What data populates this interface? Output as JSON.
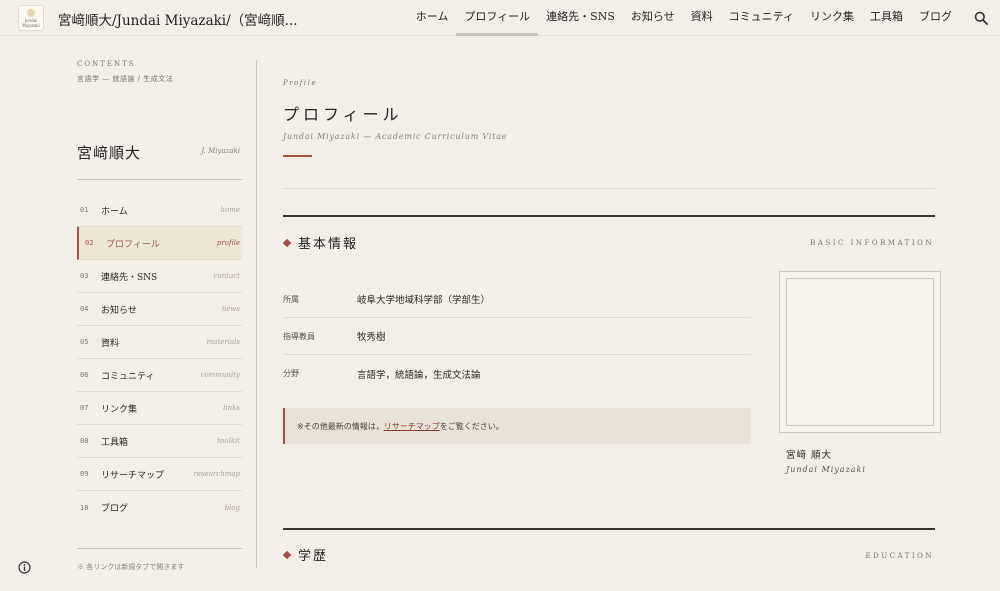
{
  "header": {
    "site_title": "宮﨑順大/Jundai Miyazaki/（宮﨑順...",
    "logo_text_1": "Jundai",
    "logo_text_2": "Miyazaki",
    "nav": [
      {
        "label": "ホーム"
      },
      {
        "label": "プロフィール"
      },
      {
        "label": "連絡先・SNS"
      },
      {
        "label": "お知らせ"
      },
      {
        "label": "資料"
      },
      {
        "label": "コミュニティ"
      },
      {
        "label": "リンク集"
      },
      {
        "label": "工具箱"
      },
      {
        "label": "ブログ"
      }
    ],
    "active_index": 1
  },
  "sidebar": {
    "contents_label": "CONTENTS",
    "contents_sub": "言語学 — 統語論 / 生成文法",
    "name": "宮﨑順大",
    "name_en": "J. Miyazaki",
    "items": [
      {
        "num": "01",
        "label": "ホーム",
        "en": "home"
      },
      {
        "num": "02",
        "label": "プロフィール",
        "en": "profile"
      },
      {
        "num": "03",
        "label": "連絡先・SNS",
        "en": "contact"
      },
      {
        "num": "04",
        "label": "お知らせ",
        "en": "news"
      },
      {
        "num": "05",
        "label": "資料",
        "en": "materials"
      },
      {
        "num": "06",
        "label": "コミュニティ",
        "en": "community"
      },
      {
        "num": "07",
        "label": "リンク集",
        "en": "links"
      },
      {
        "num": "08",
        "label": "工具箱",
        "en": "toolkit"
      },
      {
        "num": "09",
        "label": "リサーチマップ",
        "en": "researchmap"
      },
      {
        "num": "10",
        "label": "ブログ",
        "en": "blog"
      }
    ],
    "note": "※ 各リンクは新規タブで開きます"
  },
  "main": {
    "kicker": "Profile",
    "title": "プロフィール",
    "subtitle": "Jundai Miyazaki — Academic Curriculum Vitae",
    "basic": {
      "title": "基本情報",
      "title_en": "BASIC INFORMATION",
      "rows": [
        {
          "key": "所属",
          "value": "岐阜大学地域科学部（学部生）"
        },
        {
          "key": "指導教員",
          "value": "牧秀樹"
        },
        {
          "key": "分野",
          "value": "言語学，統語論，生成文法論"
        }
      ],
      "notice_pre": "※その他最新の情報は，",
      "notice_link": "リサーチマップ",
      "notice_post": "をご覧ください。"
    },
    "photo": {
      "name": "宮﨑 順大",
      "name_en": "Jundai Miyazaki"
    },
    "education": {
      "title": "学歴",
      "title_en": "EDUCATION"
    }
  }
}
